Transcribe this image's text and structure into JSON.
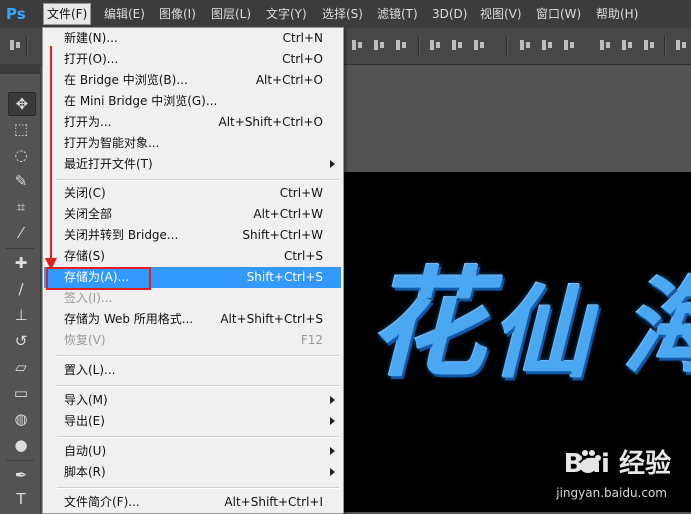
{
  "app": {
    "logo": "Ps"
  },
  "menubar": {
    "items": [
      "文件(F)",
      "编辑(E)",
      "图像(I)",
      "图层(L)",
      "文字(Y)",
      "选择(S)",
      "滤镜(T)",
      "3D(D)",
      "视图(V)",
      "窗口(W)",
      "帮助(H)"
    ],
    "active_index": 0
  },
  "file_menu": {
    "items": [
      {
        "label": "新建(N)...",
        "shortcut": "Ctrl+N"
      },
      {
        "label": "打开(O)...",
        "shortcut": "Ctrl+O"
      },
      {
        "label": "在 Bridge 中浏览(B)...",
        "shortcut": "Alt+Ctrl+O"
      },
      {
        "label": "在 Mini Bridge 中浏览(G)...",
        "shortcut": ""
      },
      {
        "label": "打开为...",
        "shortcut": "Alt+Shift+Ctrl+O"
      },
      {
        "label": "打开为智能对象...",
        "shortcut": ""
      },
      {
        "label": "最近打开文件(T)",
        "shortcut": "",
        "submenu": true
      },
      {
        "label": "关闭(C)",
        "shortcut": "Ctrl+W"
      },
      {
        "label": "关闭全部",
        "shortcut": "Alt+Ctrl+W"
      },
      {
        "label": "关闭并转到 Bridge...",
        "shortcut": "Shift+Ctrl+W"
      },
      {
        "label": "存储(S)",
        "shortcut": "Ctrl+S"
      },
      {
        "label": "存储为(A)...",
        "shortcut": "Shift+Ctrl+S",
        "highlighted": true
      },
      {
        "label": "签入(I)...",
        "shortcut": "",
        "disabled": true
      },
      {
        "label": "存储为 Web 所用格式...",
        "shortcut": "Alt+Shift+Ctrl+S"
      },
      {
        "label": "恢复(V)",
        "shortcut": "F12",
        "disabled": true
      },
      {
        "label": "置入(L)...",
        "shortcut": ""
      },
      {
        "label": "导入(M)",
        "shortcut": "",
        "submenu": true
      },
      {
        "label": "导出(E)",
        "shortcut": "",
        "submenu": true
      },
      {
        "label": "自动(U)",
        "shortcut": "",
        "submenu": true
      },
      {
        "label": "脚本(R)",
        "shortcut": "",
        "submenu": true
      },
      {
        "label": "文件简介(F)...",
        "shortcut": "Alt+Shift+Ctrl+I"
      }
    ]
  },
  "canvas": {
    "glyphs": [
      "花",
      "仙",
      "海"
    ]
  },
  "watermark": {
    "brand": "Bai 经验",
    "url": "jingyan.baidu.com"
  },
  "tools": [
    "move-tool",
    "marquee-tool",
    "lasso-tool",
    "quick-select-tool",
    "crop-tool",
    "eyedropper-tool",
    "healing-tool",
    "brush-tool",
    "stamp-tool",
    "history-brush-tool",
    "eraser-tool",
    "gradient-tool",
    "blur-tool",
    "dodge-tool",
    "pen-tool",
    "type-tool"
  ],
  "colors": {
    "highlight": "#3399ff",
    "annotation": "#e02020",
    "glyph": "#4aa8f2"
  }
}
